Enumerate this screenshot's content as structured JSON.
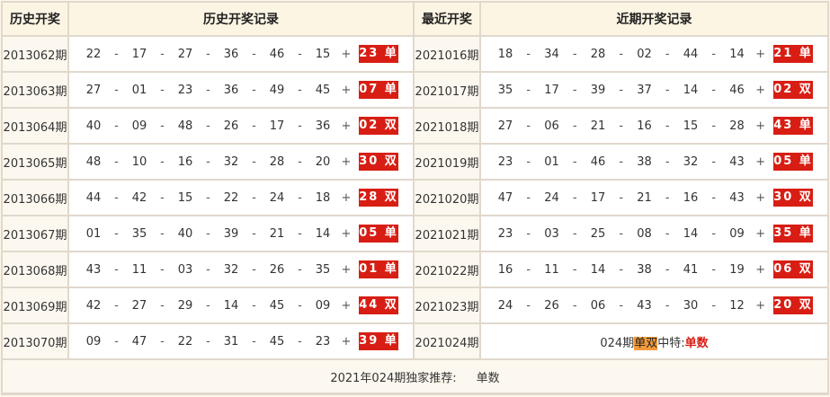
{
  "header": {
    "col1": "历史开奖",
    "col2": "历史开奖记录",
    "col3": "最近开奖",
    "col4": "近期开奖记录"
  },
  "history": [
    {
      "period": "2013062期",
      "nums": [
        "22",
        "17",
        "27",
        "36",
        "46",
        "15"
      ],
      "special": "23 单"
    },
    {
      "period": "2013063期",
      "nums": [
        "27",
        "01",
        "23",
        "36",
        "49",
        "45"
      ],
      "special": "07 单"
    },
    {
      "period": "2013064期",
      "nums": [
        "40",
        "09",
        "48",
        "26",
        "17",
        "36"
      ],
      "special": "02 双"
    },
    {
      "period": "2013065期",
      "nums": [
        "48",
        "10",
        "16",
        "32",
        "28",
        "20"
      ],
      "special": "30 双"
    },
    {
      "period": "2013066期",
      "nums": [
        "44",
        "42",
        "15",
        "22",
        "24",
        "18"
      ],
      "special": "28 双"
    },
    {
      "period": "2013067期",
      "nums": [
        "01",
        "35",
        "40",
        "39",
        "21",
        "14"
      ],
      "special": "05 单"
    },
    {
      "period": "2013068期",
      "nums": [
        "43",
        "11",
        "03",
        "32",
        "26",
        "35"
      ],
      "special": "01 单"
    },
    {
      "period": "2013069期",
      "nums": [
        "42",
        "27",
        "29",
        "14",
        "45",
        "09"
      ],
      "special": "44 双"
    },
    {
      "period": "2013070期",
      "nums": [
        "09",
        "47",
        "22",
        "31",
        "45",
        "23"
      ],
      "special": "39 单"
    }
  ],
  "recent": [
    {
      "period": "2021016期",
      "nums": [
        "18",
        "34",
        "28",
        "02",
        "44",
        "14"
      ],
      "special": "21 单"
    },
    {
      "period": "2021017期",
      "nums": [
        "35",
        "17",
        "39",
        "37",
        "14",
        "46"
      ],
      "special": "02 双"
    },
    {
      "period": "2021018期",
      "nums": [
        "27",
        "06",
        "21",
        "16",
        "15",
        "28"
      ],
      "special": "43 单"
    },
    {
      "period": "2021019期",
      "nums": [
        "23",
        "01",
        "46",
        "38",
        "32",
        "43"
      ],
      "special": "05 单"
    },
    {
      "period": "2021020期",
      "nums": [
        "47",
        "24",
        "17",
        "21",
        "16",
        "43"
      ],
      "special": "30 双"
    },
    {
      "period": "2021021期",
      "nums": [
        "23",
        "03",
        "25",
        "08",
        "14",
        "09"
      ],
      "special": "35 单"
    },
    {
      "period": "2021022期",
      "nums": [
        "16",
        "11",
        "14",
        "38",
        "41",
        "19"
      ],
      "special": "06 双"
    },
    {
      "period": "2021023期",
      "nums": [
        "24",
        "26",
        "06",
        "43",
        "30",
        "12"
      ],
      "special": "20 双"
    },
    {
      "period": "2021024期"
    }
  ],
  "prediction": {
    "prefix": "024期",
    "highlight": "单双",
    "middle": "中特:",
    "result": "单数"
  },
  "symbols": {
    "sep": "-",
    "plus": "+"
  },
  "footer": {
    "label": "2021年024期独家推荐:",
    "value": "单数"
  },
  "colors": {
    "badge": "#d81e14",
    "highlight": "#f29a3a",
    "header_bg": "#fdf5e4",
    "page_bg": "#fff7e8"
  }
}
